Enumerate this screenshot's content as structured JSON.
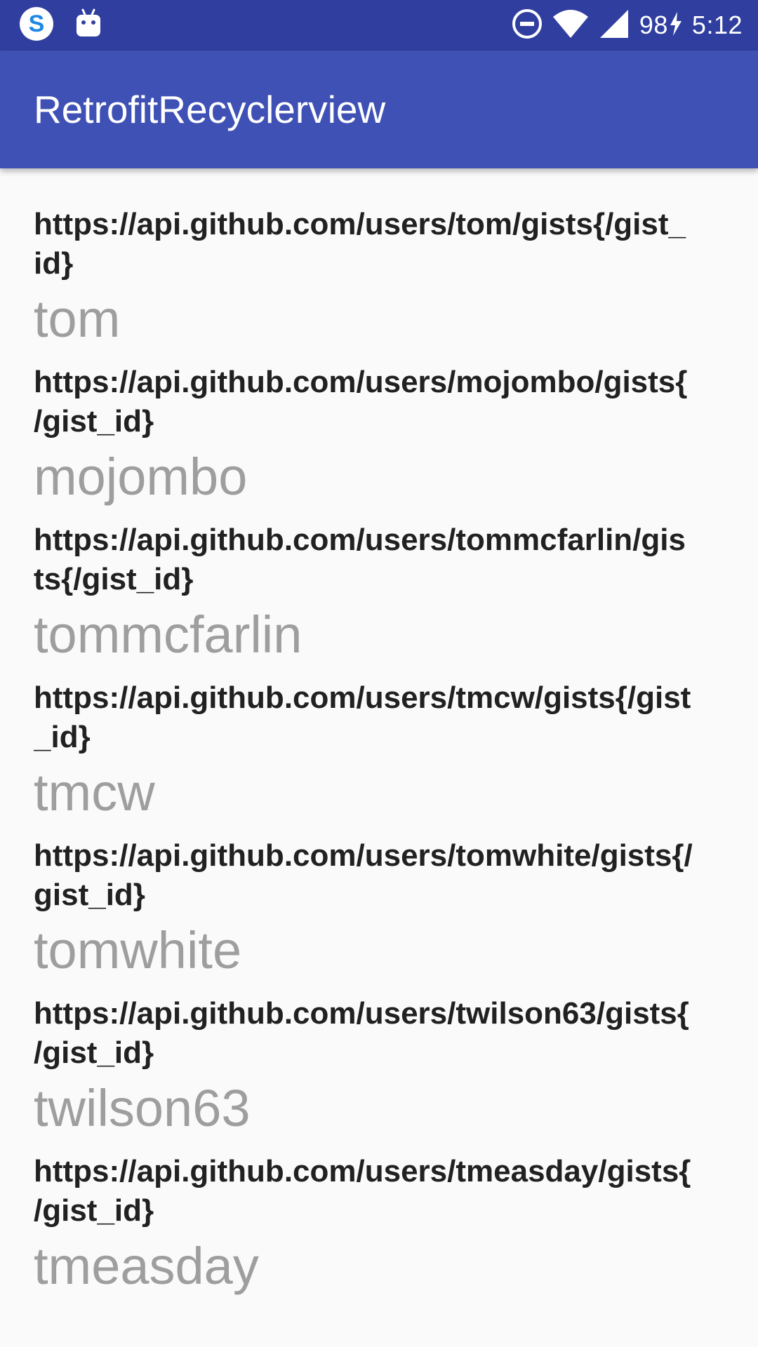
{
  "status_bar": {
    "time": "5:12",
    "battery_level": "98",
    "left_icons": [
      "skype-icon",
      "android-icon"
    ],
    "right_icons": [
      "do-not-disturb-icon",
      "wifi-icon",
      "signal-icon",
      "battery-charging-icon"
    ],
    "background_color": "#303F9F"
  },
  "app_bar": {
    "title": "RetrofitRecyclerview",
    "background_color": "#3F51B5"
  },
  "list": {
    "items": [
      {
        "url": "https://api.github.com/users/tom/gists{/gist_id}",
        "login": "tom"
      },
      {
        "url": "https://api.github.com/users/mojombo/gists{/gist_id}",
        "login": "mojombo"
      },
      {
        "url": "https://api.github.com/users/tommcfarlin/gists{/gist_id}",
        "login": "tommcfarlin"
      },
      {
        "url": "https://api.github.com/users/tmcw/gists{/gist_id}",
        "login": "tmcw"
      },
      {
        "url": "https://api.github.com/users/tomwhite/gists{/gist_id}",
        "login": "tomwhite"
      },
      {
        "url": "https://api.github.com/users/twilson63/gists{/gist_id}",
        "login": "twilson63"
      },
      {
        "url": "https://api.github.com/users/tmeasday/gists{/gist_id}",
        "login": "tmeasday"
      }
    ]
  }
}
